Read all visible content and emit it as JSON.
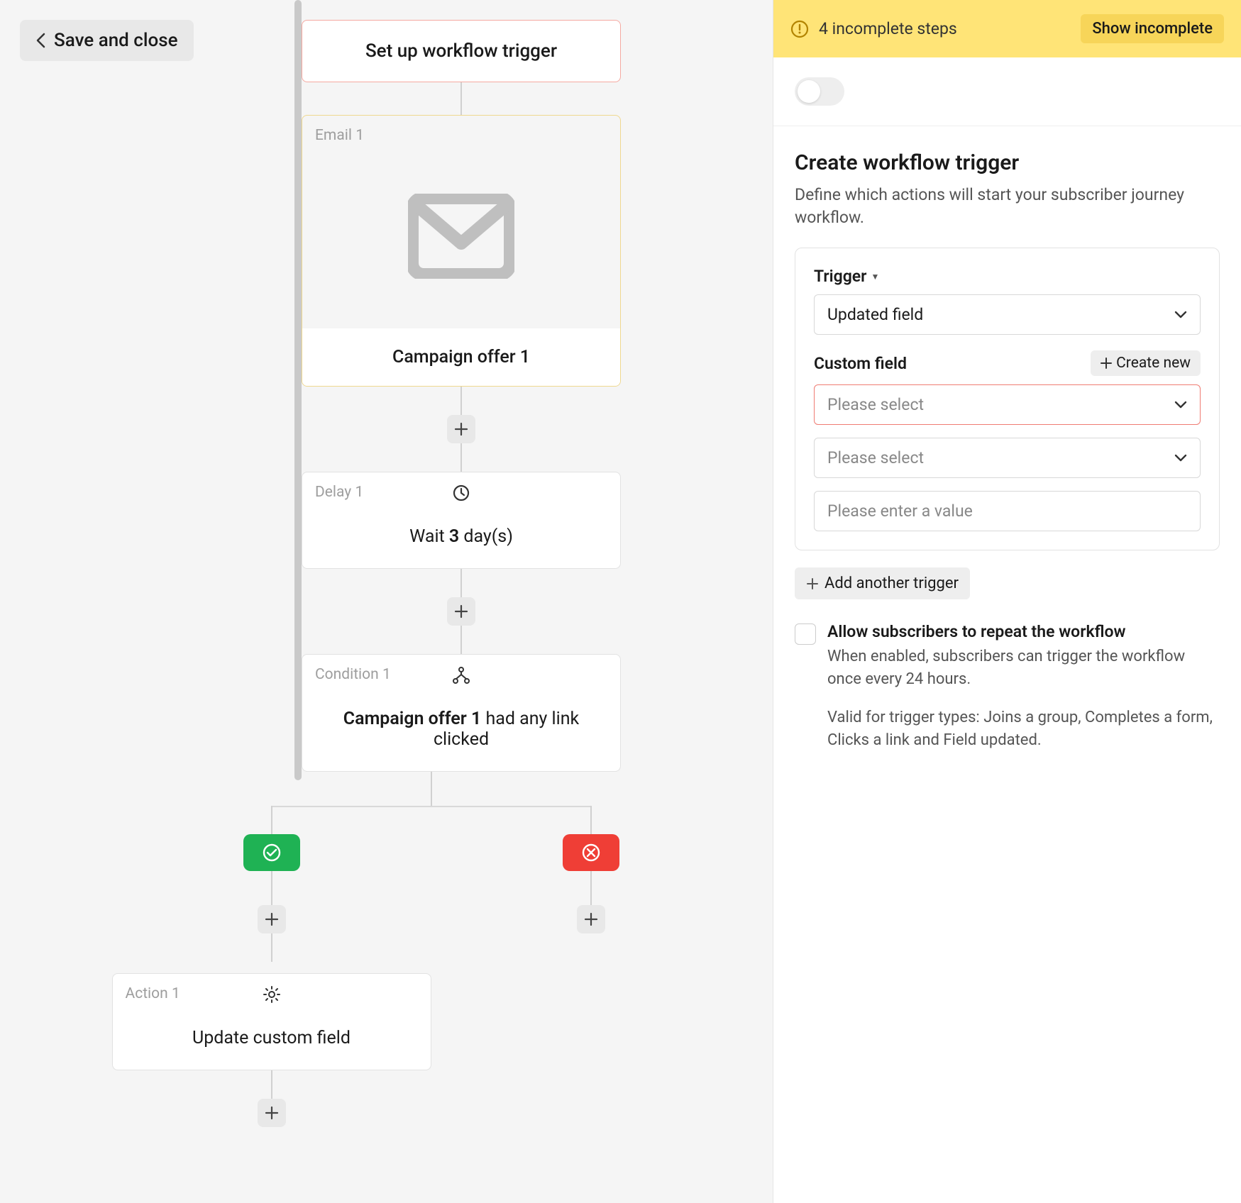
{
  "header": {
    "save_close": "Save and close"
  },
  "flow": {
    "trigger_label": "Set up workflow trigger",
    "email": {
      "tag": "Email 1",
      "title": "Campaign offer 1"
    },
    "delay": {
      "tag": "Delay 1",
      "prefix": "Wait ",
      "days": "3",
      "suffix": " day(s)"
    },
    "condition": {
      "tag": "Condition 1",
      "bold": "Campaign offer 1",
      "rest": " had any link clicked"
    },
    "action": {
      "tag": "Action 1",
      "title": "Update custom field"
    }
  },
  "sidebar": {
    "banner_text": "4 incomplete steps",
    "banner_btn": "Show incomplete",
    "title": "Create workflow trigger",
    "desc": "Define which actions will start your subscriber journey workflow.",
    "trigger_label": "Trigger",
    "trigger_value": "Updated field",
    "custom_field_label": "Custom field",
    "create_new": "Create new",
    "please_select": "Please select",
    "value_placeholder": "Please enter a value",
    "add_trigger": "Add another trigger",
    "repeat_label": "Allow subscribers to repeat the workflow",
    "repeat_desc": "When enabled, subscribers can trigger the workflow once every 24 hours.",
    "repeat_valid": "Valid for trigger types: Joins a group, Completes a form, Clicks a link and Field updated."
  }
}
